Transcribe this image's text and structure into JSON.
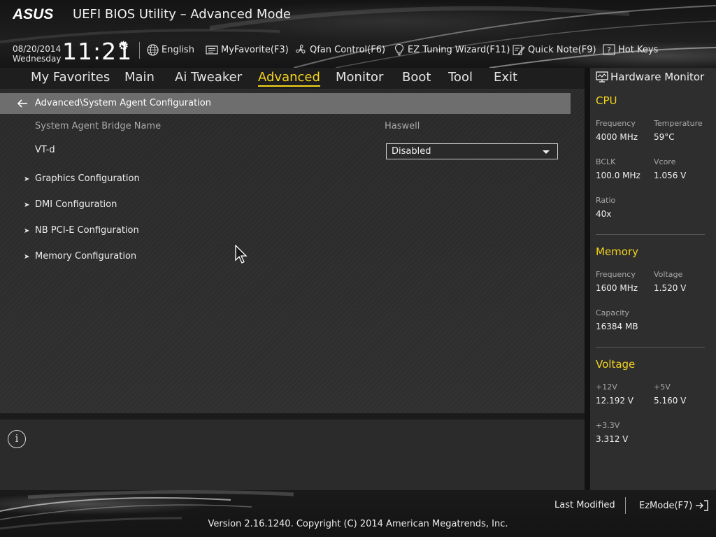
{
  "header": {
    "logo_text": "ASUS",
    "app_title": "UEFI BIOS Utility – Advanced Mode",
    "date": "08/20/2014",
    "weekday": "Wednesday",
    "time": "11:21",
    "toolbar": {
      "language": "English",
      "my_favorite": "MyFavorite(F3)",
      "qfan": "Qfan Control(F6)",
      "ez_tuning": "EZ Tuning Wizard(F11)",
      "quick_note": "Quick Note(F9)",
      "hot_keys": "Hot Keys"
    }
  },
  "menu": {
    "items": [
      {
        "label": "My Favorites"
      },
      {
        "label": "Main"
      },
      {
        "label": "Ai Tweaker"
      },
      {
        "label": "Advanced",
        "active": true
      },
      {
        "label": "Monitor"
      },
      {
        "label": "Boot"
      },
      {
        "label": "Tool"
      },
      {
        "label": "Exit"
      }
    ],
    "active_color": "#f4d41e"
  },
  "main": {
    "breadcrumb": "Advanced\\System Agent Configuration",
    "bridge_name_label": "System Agent Bridge Name",
    "bridge_name_value": "Haswell",
    "vtd_label": "VT-d",
    "vtd_value": "Disabled",
    "submenus": [
      {
        "label": "Graphics Configuration"
      },
      {
        "label": "DMI Configuration"
      },
      {
        "label": "NB PCI-E Configuration"
      },
      {
        "label": "Memory Configuration"
      }
    ]
  },
  "info": {
    "icon": "i"
  },
  "hardware_monitor": {
    "title": "Hardware Monitor",
    "cpu": {
      "heading": "CPU",
      "frequency_label": "Frequency",
      "frequency_value": "4000 MHz",
      "temperature_label": "Temperature",
      "temperature_value": "59°C",
      "bclk_label": "BCLK",
      "bclk_value": "100.0 MHz",
      "vcore_label": "Vcore",
      "vcore_value": "1.056 V",
      "ratio_label": "Ratio",
      "ratio_value": "40x"
    },
    "memory": {
      "heading": "Memory",
      "frequency_label": "Frequency",
      "frequency_value": "1600 MHz",
      "voltage_label": "Voltage",
      "voltage_value": "1.520 V",
      "capacity_label": "Capacity",
      "capacity_value": "16384 MB"
    },
    "voltage": {
      "heading": "Voltage",
      "v12_label": "+12V",
      "v12_value": "12.192 V",
      "v5_label": "+5V",
      "v5_value": "5.160 V",
      "v33_label": "+3.3V",
      "v33_value": "3.312 V"
    }
  },
  "footer": {
    "last_modified": "Last Modified",
    "ezmode": "EzMode(F7)",
    "version": "Version 2.16.1240. Copyright (C) 2014 American Megatrends, Inc."
  }
}
